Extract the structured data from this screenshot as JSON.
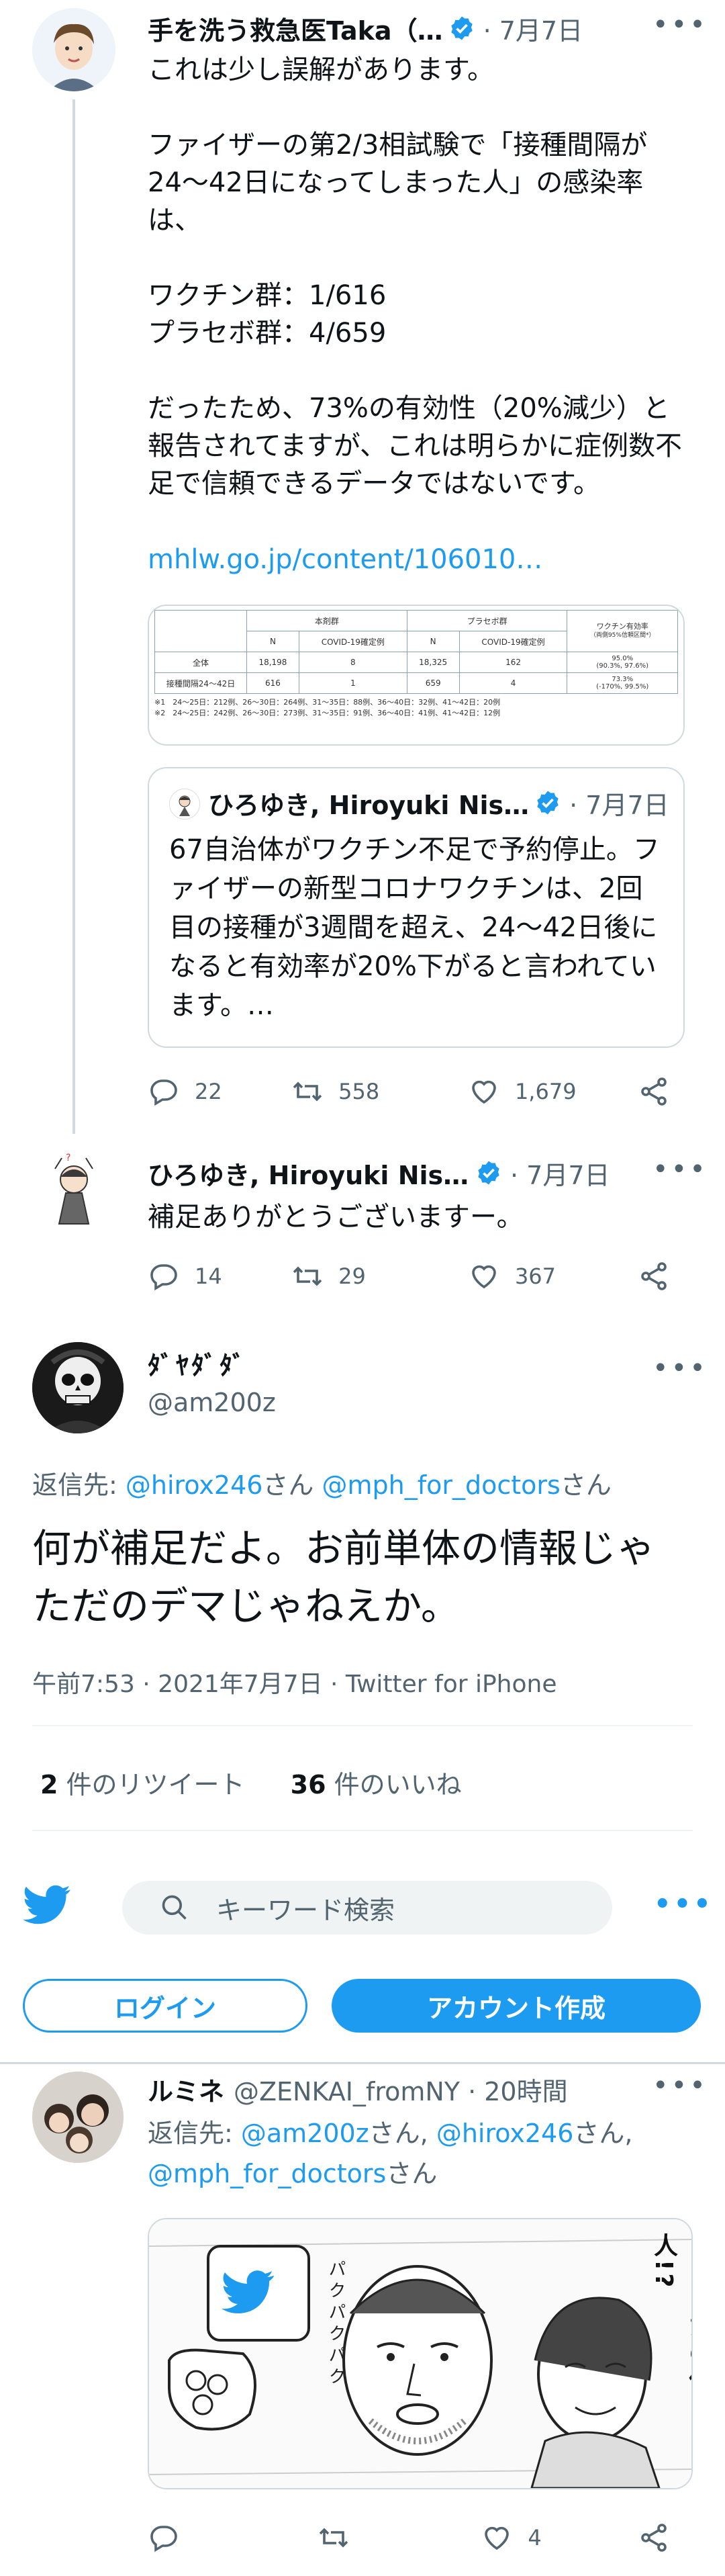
{
  "tweet1": {
    "name": "手を洗う救急医Taka（…",
    "date": "· 7月7日",
    "more": "•••",
    "text": "これは少し誤解があります。\n\nファイザーの第2/3相試験で「接種間隔が24〜42日になってしまった人」の感染率は、\n\nワクチン群：1/616\nプラセボ群：4/659\n\nだったため、73%の有効性（20%減少）と報告されてますが、これは明らかに症例数不足で信頼できるデータではないです。",
    "link": "mhlw.go.jp/content/106010…",
    "table": {
      "group_vaccine": "本剤群",
      "group_placebo": "プラセボ群",
      "col_efficacy": "ワクチン有効率",
      "col_efficacy_sub": "（両側95%信頼区間*）",
      "col_n": "N",
      "col_cases": "COVID-19確定例",
      "row_all": "全体",
      "row_all_values": [
        "18,198",
        "8",
        "18,325",
        "162",
        "95.0%",
        "(90.3%, 97.6%)"
      ],
      "row_interval": "接種間隔24〜42日",
      "row_interval_values": [
        "616",
        "1",
        "659",
        "4",
        "73.3%",
        "(-170%, 99.5%)"
      ],
      "note1": "※1　24〜25日：212例、26〜30日：264例、31〜35日：88例、36〜40日：32例、41〜42日：20例",
      "note2": "※2　24〜25日：242例、26〜30日：273例、31〜35日：91例、36〜40日：41例、41〜42日：12例"
    },
    "quote": {
      "name": "ひろゆき, Hiroyuki Nis…",
      "date": "· 7月7日",
      "text": "67自治体がワクチン不足で予約停止。ファイザーの新型コロナワクチンは、2回目の接種が3週間を超え、24〜42日後になると有効率が20%下がると言われています。…"
    },
    "replies": "22",
    "retweets": "558",
    "likes": "1,679"
  },
  "tweet2": {
    "name": "ひろゆき, Hiroyuki Nish…",
    "date": "· 7月7日",
    "more": "•••",
    "text": "補足ありがとうございますー。",
    "replies": "14",
    "retweets": "29",
    "likes": "367"
  },
  "main": {
    "name": "ﾀﾞﾔﾀﾞﾀﾞ",
    "handle": "@am200z",
    "more": "•••",
    "reply_prefix": "返信先: ",
    "reply_to_1": "@hirox246",
    "reply_mid": "さん ",
    "reply_to_2": "@mph_for_doctors",
    "reply_suffix": "さん",
    "text": "何が補足だよ。お前単体の情報じゃただのデマじゃねえか。",
    "meta": "午前7:53 · 2021年7月7日 · Twitter for iPhone",
    "retweet_count": "2",
    "retweet_label": " 件のリツイート",
    "like_count": "36",
    "like_label": " 件のいいね"
  },
  "bar": {
    "search_placeholder": "キーワード検索",
    "login": "ログイン",
    "signup": "アカウント作成",
    "more": "•••"
  },
  "reply": {
    "name": "ルミネ",
    "handle_date": "@ZENKAI_fromNY · 20時間",
    "more": "•••",
    "reply_prefix": "返信先: ",
    "to1": "@am200z",
    "mid1": "さん, ",
    "to2": "@hirox246",
    "mid2": "さん,",
    "to3": "@mph_for_doctors",
    "suffix": "さん",
    "comic_text_right": "どうしたの偉い人!?",
    "comic_text_left": "パクパクパク",
    "replies": "",
    "retweets": "",
    "likes": "4"
  },
  "colors": {
    "accent": "#1d9bf0",
    "text": "#0f1419",
    "muted": "#536471",
    "border": "#cfd9de"
  }
}
